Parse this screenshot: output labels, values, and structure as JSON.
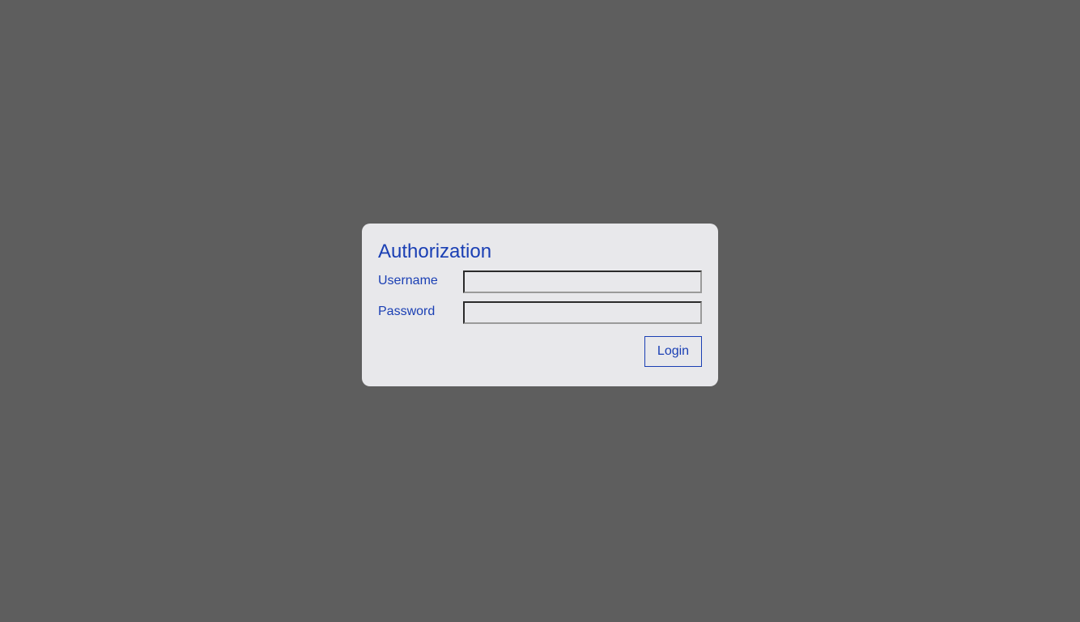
{
  "auth_dialog": {
    "title": "Authorization",
    "username": {
      "label": "Username",
      "value": ""
    },
    "password": {
      "label": "Password",
      "value": ""
    },
    "login_label": "Login"
  },
  "colors": {
    "background": "#5e5e5e",
    "card": "#e8e8eb",
    "accent": "#1a3fb4"
  }
}
